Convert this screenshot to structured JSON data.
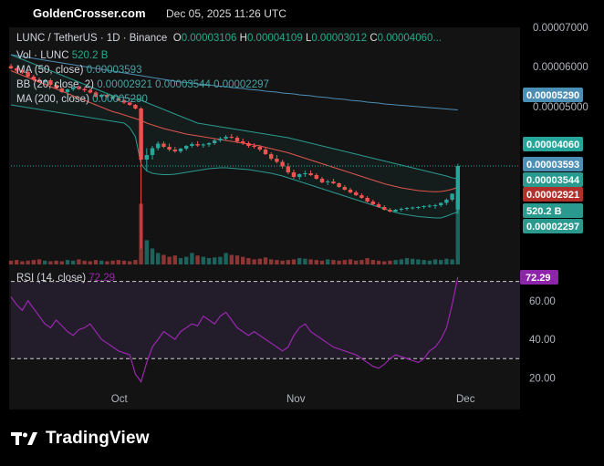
{
  "header": {
    "site": "GoldenCrosser.com",
    "timestamp": "Dec 05, 2025 11:26 UTC"
  },
  "legend": {
    "symbol": "LUNC / TetherUS · 1D · Binance",
    "open_label": "O",
    "open": "0.00003106",
    "high_label": "H",
    "high": "0.00004109",
    "low_label": "L",
    "low": "0.00003012",
    "close_label": "C",
    "close": "0.00004060...",
    "vol_label": "Vol · LUNC",
    "vol_value": "520.2 B",
    "ma50_label": "MA (50, close)",
    "ma50_value": "0.00003593",
    "bb_label": "BB (20, close, 2)",
    "bb_values": "0.00002921  0.00003544  0.00002297",
    "ma200_label": "MA (200, close)",
    "ma200_value": "0.00005290",
    "rsi_label": "RSI (14, close)",
    "rsi_value": "72.29"
  },
  "colors": {
    "up": "#26a69a",
    "down": "#ef5350",
    "ma50": "#e0554d",
    "ma200": "#4c8fb5",
    "bb": "#2a9a8f",
    "rsi": "#9c27b0",
    "rsi_label_bg": "#8e24aa"
  },
  "branding": {
    "logo_text": "TradingView",
    "logo_icon": "tradingview-logo-icon"
  },
  "chart_data": [
    {
      "type": "candlestick",
      "title": "LUNC / TetherUS · 1D · Binance",
      "y_ticks": [
        "0.00007000",
        "0.00006000",
        "0.00005000"
      ],
      "ylim": [
        1.9e-05,
        7.1e-05
      ],
      "x_ticks": [
        {
          "label": "Oct",
          "index": 19
        },
        {
          "label": "Nov",
          "index": 50
        },
        {
          "label": "Dec",
          "index": 80
        }
      ],
      "price_labels": [
        {
          "name": "MA (200, close)",
          "value": "0.00005290"
        },
        {
          "name": "Close",
          "value": "0.00004060"
        },
        {
          "name": "MA (50, close)",
          "value": "0.00003593"
        },
        {
          "name": "BB basis",
          "value": "0.00003544"
        },
        {
          "name": "BB upper/lower",
          "value": "0.00002921"
        },
        {
          "name": "Vol",
          "value": "520.2 B"
        },
        {
          "name": "BB lower",
          "value": "0.00002297"
        }
      ],
      "last_close": 4.06e-05,
      "candles_ohlc_1e-8": [
        [
          6250,
          6300,
          6180,
          6200
        ],
        [
          6200,
          6230,
          6120,
          6150
        ],
        [
          6150,
          6200,
          6080,
          6120
        ],
        [
          6120,
          6140,
          6000,
          6020
        ],
        [
          6020,
          6060,
          5920,
          5950
        ],
        [
          5950,
          6000,
          5880,
          5900
        ],
        [
          5900,
          5960,
          5860,
          5940
        ],
        [
          5940,
          5980,
          5820,
          5840
        ],
        [
          5840,
          5880,
          5740,
          5760
        ],
        [
          5760,
          5800,
          5660,
          5680
        ],
        [
          5680,
          5760,
          5640,
          5740
        ],
        [
          5740,
          5800,
          5700,
          5780
        ],
        [
          5780,
          5820,
          5730,
          5750
        ],
        [
          5750,
          5790,
          5680,
          5720
        ],
        [
          5720,
          5760,
          5650,
          5670
        ],
        [
          5670,
          5700,
          5560,
          5580
        ],
        [
          5580,
          5640,
          5550,
          5620
        ],
        [
          5620,
          5650,
          5560,
          5580
        ],
        [
          5580,
          5600,
          5520,
          5540
        ],
        [
          5540,
          5560,
          5480,
          5500
        ],
        [
          5500,
          5520,
          5420,
          5450
        ],
        [
          5450,
          5470,
          5380,
          5400
        ],
        [
          5400,
          5420,
          5300,
          5320
        ],
        [
          5320,
          5350,
          2250,
          4200
        ],
        [
          4200,
          4450,
          3950,
          4300
        ],
        [
          4300,
          4500,
          4200,
          4450
        ],
        [
          4450,
          4600,
          4400,
          4550
        ],
        [
          4550,
          4600,
          4450,
          4480
        ],
        [
          4480,
          4550,
          4380,
          4420
        ],
        [
          4420,
          4480,
          4350,
          4380
        ],
        [
          4380,
          4460,
          4340,
          4440
        ],
        [
          4440,
          4520,
          4400,
          4500
        ],
        [
          4500,
          4580,
          4460,
          4540
        ],
        [
          4540,
          4600,
          4480,
          4510
        ],
        [
          4510,
          4560,
          4460,
          4530
        ],
        [
          4530,
          4580,
          4480,
          4560
        ],
        [
          4560,
          4650,
          4520,
          4620
        ],
        [
          4620,
          4700,
          4580,
          4660
        ],
        [
          4660,
          4740,
          4620,
          4700
        ],
        [
          4700,
          4760,
          4650,
          4680
        ],
        [
          4680,
          4720,
          4560,
          4600
        ],
        [
          4600,
          4660,
          4520,
          4560
        ],
        [
          4560,
          4600,
          4460,
          4500
        ],
        [
          4500,
          4560,
          4440,
          4480
        ],
        [
          4480,
          4520,
          4380,
          4420
        ],
        [
          4420,
          4480,
          4300,
          4320
        ],
        [
          4320,
          4360,
          4180,
          4220
        ],
        [
          4220,
          4300,
          4120,
          4150
        ],
        [
          4150,
          4200,
          4000,
          4050
        ],
        [
          4050,
          4120,
          3880,
          3920
        ],
        [
          3920,
          3980,
          3780,
          3820
        ],
        [
          3820,
          3900,
          3760,
          3880
        ],
        [
          3880,
          3960,
          3820,
          3900
        ],
        [
          3900,
          3960,
          3840,
          3860
        ],
        [
          3860,
          3900,
          3760,
          3780
        ],
        [
          3780,
          3820,
          3680,
          3700
        ],
        [
          3700,
          3760,
          3640,
          3720
        ],
        [
          3720,
          3780,
          3660,
          3680
        ],
        [
          3680,
          3700,
          3580,
          3600
        ],
        [
          3600,
          3640,
          3520,
          3540
        ],
        [
          3540,
          3580,
          3460,
          3480
        ],
        [
          3480,
          3520,
          3400,
          3420
        ],
        [
          3420,
          3460,
          3340,
          3360
        ],
        [
          3360,
          3400,
          3260,
          3280
        ],
        [
          3280,
          3320,
          3200,
          3220
        ],
        [
          3220,
          3260,
          3140,
          3160
        ],
        [
          3160,
          3200,
          3080,
          3100
        ],
        [
          3100,
          3140,
          3040,
          3060
        ],
        [
          3060,
          3120,
          3030,
          3100
        ],
        [
          3100,
          3150,
          3060,
          3120
        ],
        [
          3120,
          3160,
          3080,
          3140
        ],
        [
          3140,
          3170,
          3100,
          3150
        ],
        [
          3150,
          3180,
          3110,
          3160
        ],
        [
          3160,
          3200,
          3120,
          3180
        ],
        [
          3180,
          3220,
          3140,
          3190
        ],
        [
          3190,
          3230,
          3120,
          3200
        ],
        [
          3200,
          3260,
          3160,
          3250
        ],
        [
          3250,
          3350,
          3200,
          3320
        ],
        [
          3320,
          3460,
          3280,
          3450
        ],
        [
          3106,
          4109,
          3012,
          4060
        ]
      ],
      "ma50_1e-8": [
        6150,
        6100,
        6050,
        6000,
        5950,
        5900,
        5850,
        5800,
        5750,
        5700,
        5650,
        5600,
        5550,
        5500,
        5450,
        5400,
        5350,
        5300,
        5250,
        5220,
        5180,
        5140,
        5100,
        5060,
        5000,
        4960,
        4920,
        4880,
        4850,
        4820,
        4790,
        4760,
        4740,
        4720,
        4700,
        4680,
        4660,
        4640,
        4620,
        4600,
        4580,
        4560,
        4540,
        4520,
        4500,
        4470,
        4440,
        4410,
        4380,
        4350,
        4310,
        4270,
        4230,
        4190,
        4150,
        4110,
        4070,
        4030,
        3990,
        3950,
        3910,
        3870,
        3830,
        3790,
        3750,
        3710,
        3670,
        3640,
        3610,
        3580,
        3560,
        3540,
        3520,
        3510,
        3500,
        3495,
        3500,
        3520,
        3550,
        3593
      ],
      "ma200_1e-8": [
        6500,
        6480,
        6460,
        6440,
        6420,
        6400,
        6380,
        6360,
        6340,
        6320,
        6300,
        6280,
        6260,
        6240,
        6220,
        6200,
        6180,
        6160,
        6140,
        6120,
        6100,
        6080,
        6060,
        6040,
        6020,
        6000,
        5980,
        5960,
        5940,
        5920,
        5900,
        5890,
        5880,
        5860,
        5850,
        5840,
        5820,
        5810,
        5800,
        5780,
        5770,
        5760,
        5740,
        5730,
        5720,
        5700,
        5690,
        5680,
        5660,
        5650,
        5640,
        5620,
        5610,
        5600,
        5580,
        5570,
        5560,
        5540,
        5530,
        5520,
        5500,
        5490,
        5480,
        5460,
        5450,
        5440,
        5420,
        5410,
        5400,
        5390,
        5380,
        5370,
        5360,
        5350,
        5340,
        5330,
        5320,
        5310,
        5300,
        5290
      ],
      "bb_upper_1e-8": [
        6500,
        6450,
        6400,
        6350,
        6300,
        6250,
        6200,
        6150,
        6100,
        6050,
        6000,
        5950,
        5900,
        5850,
        5800,
        5750,
        5700,
        5650,
        5600,
        5580,
        5560,
        5540,
        5520,
        5500,
        5450,
        5400,
        5350,
        5300,
        5250,
        5200,
        5150,
        5100,
        5050,
        5000,
        4980,
        4960,
        4940,
        4920,
        4900,
        4880,
        4860,
        4840,
        4820,
        4800,
        4780,
        4760,
        4740,
        4720,
        4700,
        4680,
        4650,
        4620,
        4590,
        4560,
        4530,
        4500,
        4470,
        4440,
        4410,
        4380,
        4350,
        4320,
        4290,
        4260,
        4230,
        4200,
        4170,
        4140,
        4110,
        4080,
        4050,
        4020,
        3990,
        3960,
        3930,
        3900,
        3870,
        3840,
        3800,
        3780
      ],
      "bb_lower_1e-8": [
        5400,
        5380,
        5360,
        5340,
        5320,
        5300,
        5280,
        5260,
        5240,
        5220,
        5200,
        5180,
        5160,
        5140,
        5120,
        5100,
        5080,
        5060,
        5040,
        5020,
        5000,
        4900,
        4700,
        4100,
        3950,
        3900,
        3880,
        3870,
        3870,
        3880,
        3900,
        3920,
        3940,
        3960,
        3980,
        4000,
        4010,
        4020,
        4020,
        4010,
        4000,
        3990,
        3980,
        3960,
        3940,
        3920,
        3900,
        3870,
        3840,
        3800,
        3760,
        3720,
        3680,
        3640,
        3600,
        3560,
        3520,
        3480,
        3440,
        3400,
        3360,
        3320,
        3280,
        3240,
        3200,
        3160,
        3120,
        3080,
        3040,
        3010,
        2990,
        2970,
        2950,
        2940,
        2930,
        2920,
        2921,
        2960,
        3010,
        3050
      ],
      "volumes_rel": [
        0.06,
        0.07,
        0.05,
        0.06,
        0.07,
        0.08,
        0.06,
        0.05,
        0.06,
        0.05,
        0.07,
        0.06,
        0.08,
        0.06,
        0.05,
        0.07,
        0.06,
        0.05,
        0.06,
        0.07,
        0.06,
        0.05,
        0.07,
        0.95,
        0.38,
        0.25,
        0.18,
        0.15,
        0.12,
        0.14,
        0.1,
        0.12,
        0.18,
        0.14,
        0.12,
        0.1,
        0.11,
        0.12,
        0.18,
        0.15,
        0.14,
        0.12,
        0.1,
        0.08,
        0.09,
        0.11,
        0.08,
        0.07,
        0.06,
        0.07,
        0.08,
        0.1,
        0.09,
        0.08,
        0.07,
        0.06,
        0.08,
        0.07,
        0.06,
        0.07,
        0.08,
        0.06,
        0.07,
        0.1,
        0.07,
        0.06,
        0.05,
        0.06,
        0.07,
        0.08,
        0.1,
        0.09,
        0.08,
        0.07,
        0.06,
        0.08,
        0.07,
        0.09,
        0.08,
        1.0
      ],
      "volume_label": "520.2 B"
    },
    {
      "type": "line",
      "title": "RSI (14, close)",
      "y_ticks": [
        60,
        40,
        20
      ],
      "bands": [
        70,
        30
      ],
      "ylim": [
        15,
        75
      ],
      "series": [
        {
          "name": "RSI (14, close)",
          "values": [
            62,
            58,
            55,
            60,
            56,
            52,
            48,
            46,
            50,
            47,
            44,
            42,
            45,
            46,
            48,
            44,
            40,
            38,
            36,
            34,
            33,
            32,
            22,
            18,
            28,
            36,
            40,
            44,
            42,
            40,
            44,
            46,
            48,
            47,
            52,
            50,
            48,
            52,
            54,
            50,
            46,
            44,
            42,
            44,
            42,
            40,
            38,
            36,
            34,
            36,
            42,
            46,
            48,
            44,
            42,
            40,
            38,
            36,
            35,
            34,
            33,
            32,
            30,
            28,
            26,
            25,
            27,
            30,
            32,
            31,
            30,
            29,
            28,
            30,
            34,
            36,
            40,
            46,
            58,
            72.29
          ]
        }
      ],
      "last_label": "72.29"
    }
  ]
}
